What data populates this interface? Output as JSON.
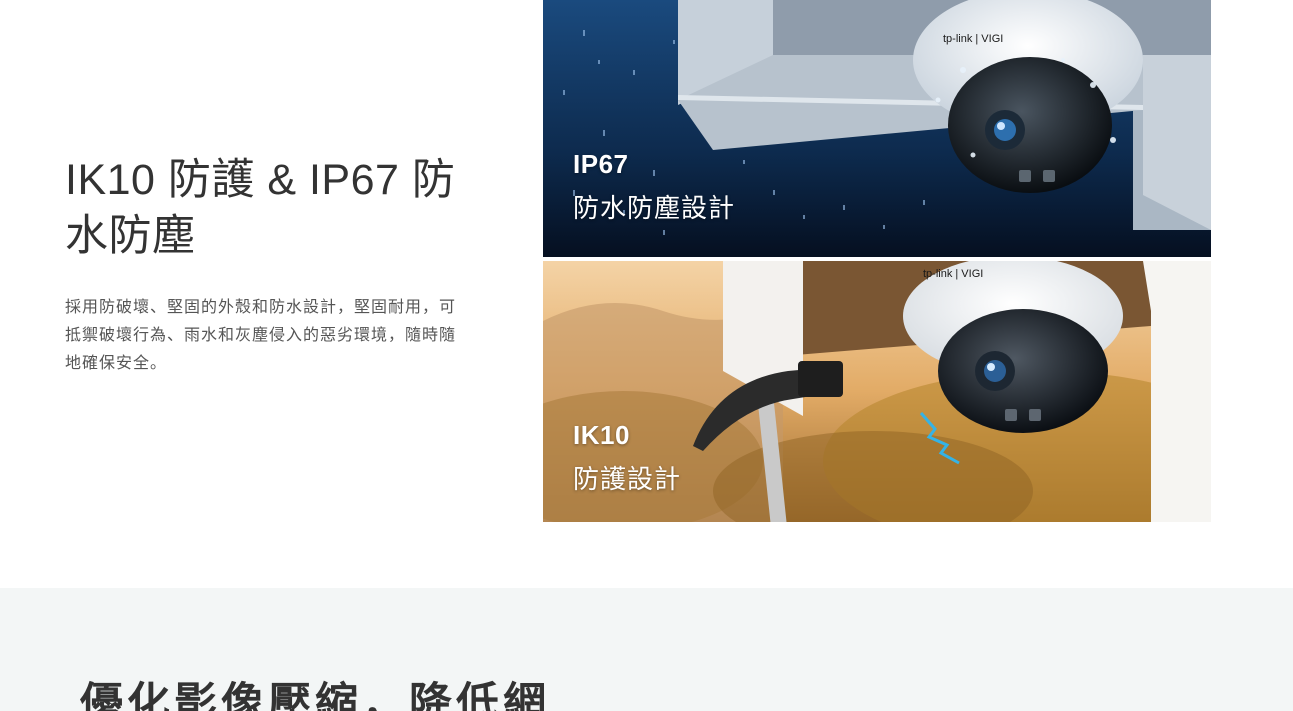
{
  "feature": {
    "heading": "IK10 防護 & IP67 防水防塵",
    "description": "採用防破壞、堅固的外殼和防水設計，堅固耐用，可抵禦破壞行為、雨水和灰塵侵入的惡劣環境，隨時隨地確保安全。"
  },
  "panels": [
    {
      "title": "IP67",
      "subtitle": "防水防塵設計",
      "brand": "tp-link | VIGI"
    },
    {
      "title": "IK10",
      "subtitle": "防護設計",
      "brand": "tp-link | VIGI"
    }
  ],
  "next_section": {
    "heading": "優化影像壓縮，降低網"
  },
  "colors": {
    "heading_text": "#333333",
    "body_text": "#555555",
    "bottom_bg": "#f3f6f6",
    "panel1_bg": "#0f2e55",
    "panel2_bg": "#c79550"
  }
}
